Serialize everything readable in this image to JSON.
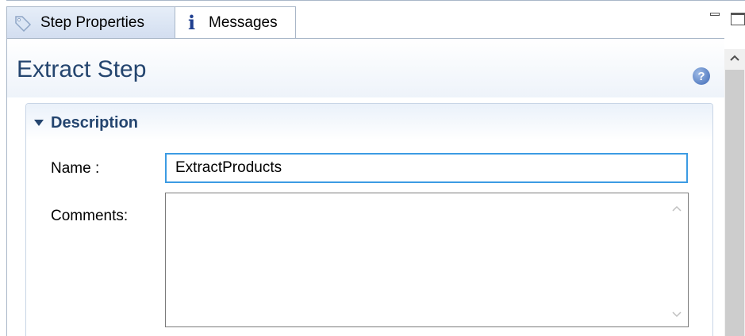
{
  "tabs": [
    {
      "label": "Step Properties",
      "icon": "tag-icon",
      "active": true
    },
    {
      "label": "Messages",
      "icon": "info-icon",
      "active": false
    }
  ],
  "header": {
    "title": "Extract Step",
    "help_icon": "help-icon"
  },
  "section": {
    "title": "Description",
    "expanded": true
  },
  "form": {
    "name_label": "Name :",
    "name_value": "ExtractProducts",
    "comments_label": "Comments:",
    "comments_value": ""
  },
  "colors": {
    "title": "#24456f",
    "focus_border": "#3c9be3",
    "tab_active": "#d3def0",
    "border": "#a9b7c8"
  }
}
